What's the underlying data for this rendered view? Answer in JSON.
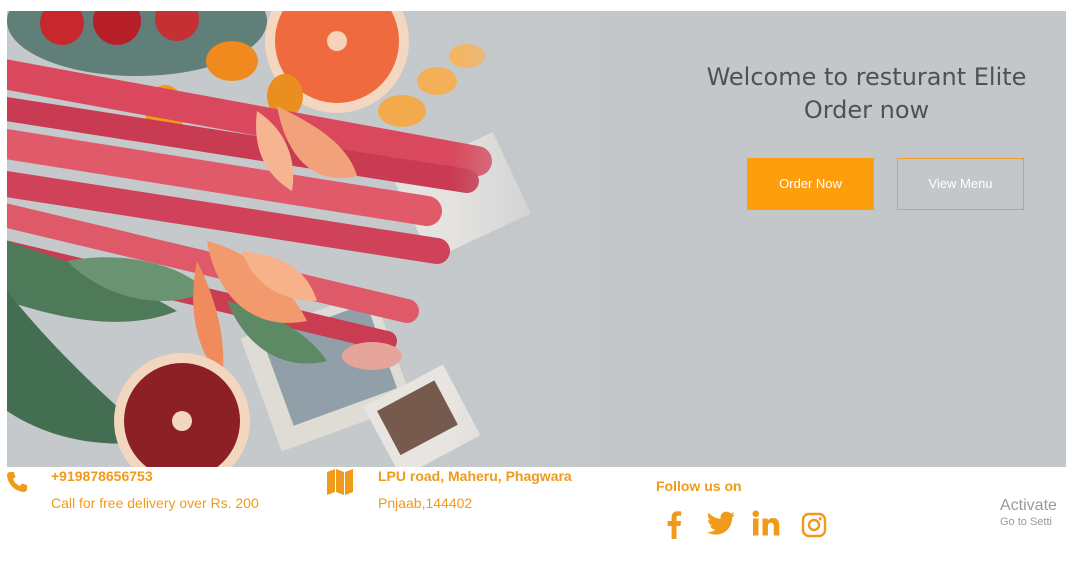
{
  "hero": {
    "title_line1": "Welcome to resturant Elite",
    "title_line2": "Order now",
    "order_button": "Order Now",
    "menu_button": "View Menu"
  },
  "contact": {
    "phone": "+919878656753",
    "phone_note": "Call for free delivery over Rs. 200",
    "address_line1": "LPU road, Maheru, Phagwara",
    "address_line2": "Pnjaab,144402"
  },
  "social": {
    "heading": "Follow us on",
    "icons": [
      "facebook-icon",
      "twitter-icon",
      "linkedin-icon",
      "instagram-icon"
    ]
  },
  "watermark": {
    "line1": "Activate",
    "line2": "Go to Setti"
  },
  "colors": {
    "accent": "#ff9e0c",
    "hero_bg": "#c3c7c9",
    "title": "#4f5154"
  }
}
